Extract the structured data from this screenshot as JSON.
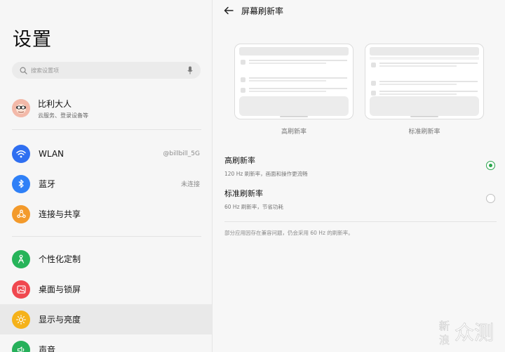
{
  "left": {
    "title": "设置",
    "search_placeholder": "搜索设置项",
    "account": {
      "name": "比利大人",
      "subtitle": "云服务、登录设备等"
    },
    "items": [
      {
        "label": "WLAN",
        "value": "@billbill_5G",
        "icon": "wifi-icon",
        "color": "#2f6ff1"
      },
      {
        "label": "蓝牙",
        "value": "未连接",
        "icon": "bluetooth-icon",
        "color": "#2f80f7"
      },
      {
        "label": "连接与共享",
        "value": "",
        "icon": "share-icon",
        "color": "#f39a2b"
      },
      {
        "label": "个性化定制",
        "value": "",
        "icon": "personalize-icon",
        "color": "#27b45a"
      },
      {
        "label": "桌面与锁屏",
        "value": "",
        "icon": "wallpaper-icon",
        "color": "#f0484f"
      },
      {
        "label": "显示与亮度",
        "value": "",
        "icon": "brightness-icon",
        "color": "#f5b21a"
      },
      {
        "label": "声音",
        "value": "",
        "icon": "sound-icon",
        "color": "#26b05a"
      }
    ]
  },
  "right": {
    "title": "屏幕刷新率",
    "previews": [
      {
        "caption": "高刷新率"
      },
      {
        "caption": "标准刷新率"
      }
    ],
    "options": [
      {
        "title": "高刷新率",
        "desc": "120 Hz 刷新率，画面和操作更流畅",
        "selected": true
      },
      {
        "title": "标准刷新率",
        "desc": "60 Hz 刷新率，节省功耗",
        "selected": false
      }
    ],
    "note": "部分应用因存在兼容问题，仍会采用 60 Hz 的刷新率。"
  },
  "watermark": {
    "line1": "新",
    "line2": "浪",
    "brand": "众测"
  },
  "colors": {
    "accent_green": "#2aa44c",
    "active_row": "#e9e9e9"
  }
}
